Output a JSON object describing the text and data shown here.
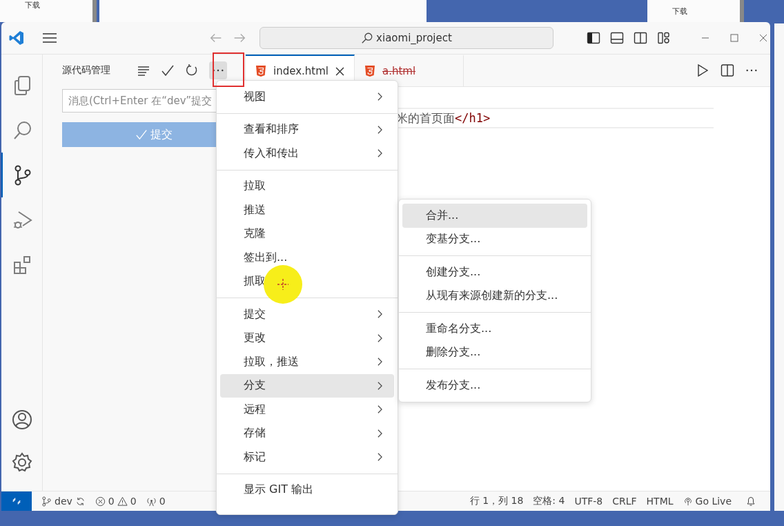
{
  "desktop": {
    "left_window_item": "下载",
    "right_window_item": "下载"
  },
  "window": {
    "search": "xiaomi_project"
  },
  "activity_bar": [
    {
      "kind": "explorer",
      "selected": false
    },
    {
      "kind": "search",
      "selected": false
    },
    {
      "kind": "scm",
      "selected": true
    },
    {
      "kind": "debug",
      "selected": false
    },
    {
      "kind": "extensions",
      "selected": false
    }
  ],
  "sidebar": {
    "title": "源代码管理",
    "message_placeholder": "消息(Ctrl+Enter 在“dev”提交",
    "commit_label": "提交"
  },
  "tabs": [
    {
      "label": "index.html",
      "selected": true,
      "deleted": false
    },
    {
      "label": "a.html",
      "selected": false,
      "deleted": true
    }
  ],
  "editor": {
    "text": "米的首页面",
    "tag": "</h1>"
  },
  "menu": [
    {
      "kind": "item",
      "label": "视图",
      "submenu": true,
      "selected": false
    },
    {
      "kind": "separator"
    },
    {
      "kind": "item",
      "label": "查看和排序",
      "submenu": true,
      "selected": false
    },
    {
      "kind": "item",
      "label": "传入和传出",
      "submenu": true,
      "selected": false
    },
    {
      "kind": "separator"
    },
    {
      "kind": "item",
      "label": "拉取",
      "submenu": false,
      "selected": false
    },
    {
      "kind": "item",
      "label": "推送",
      "submenu": false,
      "selected": false
    },
    {
      "kind": "item",
      "label": "克隆",
      "submenu": false,
      "selected": false
    },
    {
      "kind": "item",
      "label": "签出到...",
      "submenu": false,
      "selected": false
    },
    {
      "kind": "item",
      "label": "抓取",
      "submenu": false,
      "selected": false
    },
    {
      "kind": "separator"
    },
    {
      "kind": "item",
      "label": "提交",
      "submenu": true,
      "selected": false
    },
    {
      "kind": "item",
      "label": "更改",
      "submenu": true,
      "selected": false
    },
    {
      "kind": "item",
      "label": "拉取，推送",
      "submenu": true,
      "selected": false
    },
    {
      "kind": "item",
      "label": "分支",
      "submenu": true,
      "selected": true
    },
    {
      "kind": "item",
      "label": "远程",
      "submenu": true,
      "selected": false
    },
    {
      "kind": "item",
      "label": "存储",
      "submenu": true,
      "selected": false
    },
    {
      "kind": "item",
      "label": "标记",
      "submenu": true,
      "selected": false
    },
    {
      "kind": "separator"
    },
    {
      "kind": "item",
      "label": "显示 GIT 输出",
      "submenu": false,
      "selected": false
    }
  ],
  "submenu": [
    {
      "kind": "item",
      "label": "合并...",
      "selected": true
    },
    {
      "kind": "item",
      "label": "变基分支...",
      "selected": false
    },
    {
      "kind": "separator"
    },
    {
      "kind": "item",
      "label": "创建分支...",
      "selected": false
    },
    {
      "kind": "item",
      "label": "从现有来源创建新的分支...",
      "selected": false
    },
    {
      "kind": "separator"
    },
    {
      "kind": "item",
      "label": "重命名分支...",
      "selected": false
    },
    {
      "kind": "item",
      "label": "删除分支...",
      "selected": false
    },
    {
      "kind": "separator"
    },
    {
      "kind": "item",
      "label": "发布分支...",
      "selected": false
    }
  ],
  "status_bar": {
    "branch": "dev",
    "errors": "0",
    "warnings": "0",
    "ports": "0",
    "right": [
      "行 1，列 18",
      "空格: 4",
      "UTF-8",
      "CRLF",
      "HTML",
      "Go Live"
    ]
  }
}
